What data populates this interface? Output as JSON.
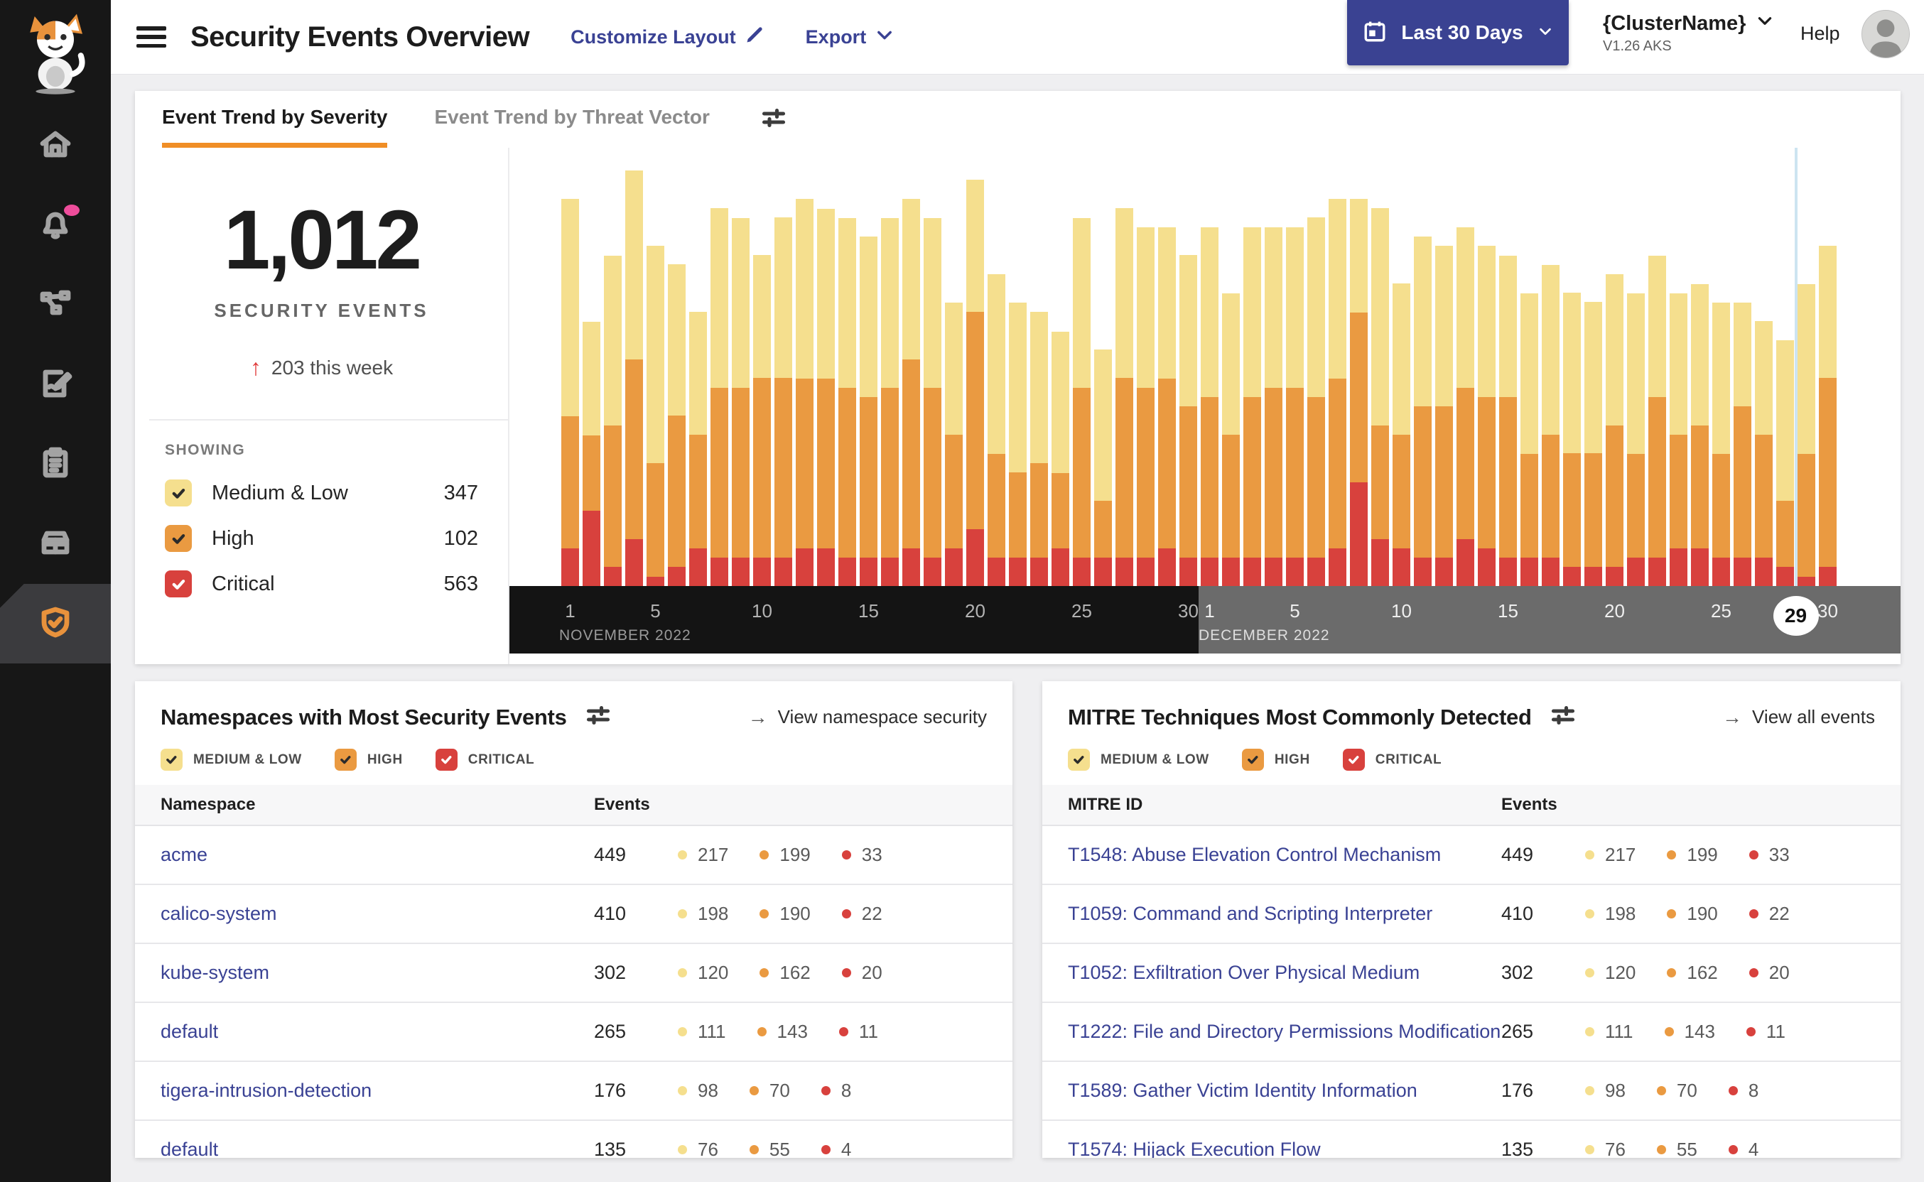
{
  "header": {
    "title": "Security Events Overview",
    "customize_layout": "Customize Layout",
    "export": "Export",
    "date_range": "Last 30 Days",
    "cluster_name": "{ClusterName}",
    "cluster_version": "V1.26 AKS",
    "help": "Help"
  },
  "sidebar": {
    "items": [
      {
        "icon": "home-icon"
      },
      {
        "icon": "bell-icon",
        "badge": true
      },
      {
        "icon": "service-graph-icon"
      },
      {
        "icon": "policy-edit-icon"
      },
      {
        "icon": "compliance-clipboard-icon"
      },
      {
        "icon": "workload-box-icon"
      },
      {
        "icon": "security-shield-icon",
        "active": true
      }
    ]
  },
  "tabs": {
    "items": [
      {
        "label": "Event Trend by Severity",
        "active": true
      },
      {
        "label": "Event Trend by Threat Vector",
        "active": false
      }
    ]
  },
  "summary": {
    "total": "1,012",
    "caption": "SECURITY EVENTS",
    "delta": "203 this week",
    "showing": "SHOWING",
    "legend": [
      {
        "label": "Medium & Low",
        "count": "347",
        "severity": "medium_low"
      },
      {
        "label": "High",
        "count": "102",
        "severity": "high"
      },
      {
        "label": "Critical",
        "count": "563",
        "severity": "critical"
      }
    ]
  },
  "severity_palette": {
    "medium_low": "#F5DF8E",
    "high": "#EA9A41",
    "critical": "#D8413D"
  },
  "chart_data": {
    "type": "bar",
    "stacked": true,
    "series": [
      "Critical",
      "High",
      "Medium & Low"
    ],
    "series_colors": {
      "Critical": "#D8413D",
      "High": "#EA9A41",
      "Medium & Low": "#F5DF8E"
    },
    "y_axis_visible": false,
    "legend_position": "left-panel",
    "highlighted_day": {
      "month": "DECEMBER 2022",
      "day": "29"
    },
    "months": [
      {
        "label": "NOVEMBER 2022",
        "ticks": [
          "1",
          "5",
          "10",
          "15",
          "20",
          "25",
          "30"
        ],
        "values_critical_high_medium": [
          [
            4,
            14,
            23
          ],
          [
            8,
            8,
            12
          ],
          [
            2,
            15,
            18
          ],
          [
            5,
            19,
            20
          ],
          [
            1,
            12,
            23
          ],
          [
            2,
            16,
            16
          ],
          [
            4,
            12,
            13
          ],
          [
            3,
            18,
            19
          ],
          [
            3,
            18,
            18
          ],
          [
            3,
            19,
            13
          ],
          [
            3,
            19,
            17
          ],
          [
            4,
            18,
            19
          ],
          [
            4,
            18,
            18
          ],
          [
            3,
            18,
            18
          ],
          [
            3,
            17,
            17
          ],
          [
            3,
            18,
            18
          ],
          [
            4,
            20,
            17
          ],
          [
            3,
            18,
            18
          ],
          [
            4,
            12,
            14
          ],
          [
            6,
            23,
            14
          ],
          [
            3,
            11,
            19
          ],
          [
            3,
            9,
            18
          ],
          [
            3,
            10,
            16
          ],
          [
            4,
            8,
            15
          ],
          [
            3,
            18,
            18
          ],
          [
            3,
            6,
            16
          ],
          [
            3,
            19,
            18
          ],
          [
            3,
            18,
            17
          ],
          [
            4,
            18,
            16
          ],
          [
            3,
            16,
            16
          ]
        ]
      },
      {
        "label": "DECEMBER 2022",
        "ticks": [
          "1",
          "5",
          "10",
          "15",
          "20",
          "25",
          "30"
        ],
        "values_critical_high_medium": [
          [
            3,
            17,
            18
          ],
          [
            3,
            13,
            15
          ],
          [
            3,
            17,
            18
          ],
          [
            3,
            18,
            17
          ],
          [
            3,
            18,
            17
          ],
          [
            3,
            17,
            19
          ],
          [
            4,
            18,
            19
          ],
          [
            11,
            18,
            12
          ],
          [
            5,
            12,
            23
          ],
          [
            4,
            12,
            16
          ],
          [
            3,
            16,
            18
          ],
          [
            3,
            16,
            17
          ],
          [
            5,
            16,
            17
          ],
          [
            4,
            16,
            16
          ],
          [
            3,
            17,
            15
          ],
          [
            3,
            11,
            17
          ],
          [
            3,
            13,
            18
          ],
          [
            2,
            12,
            17
          ],
          [
            2,
            12,
            16
          ],
          [
            2,
            15,
            16
          ],
          [
            3,
            11,
            17
          ],
          [
            3,
            17,
            15
          ],
          [
            4,
            12,
            15
          ],
          [
            4,
            13,
            15
          ],
          [
            3,
            11,
            16
          ],
          [
            3,
            16,
            11
          ],
          [
            3,
            13,
            12
          ],
          [
            2,
            7,
            17
          ],
          [
            1,
            13,
            18
          ],
          [
            2,
            20,
            14
          ]
        ]
      }
    ]
  },
  "namespaces_card": {
    "title": "Namespaces with Most Security Events",
    "link": "View namespace security",
    "filters": [
      {
        "label": "MEDIUM & LOW",
        "severity": "medium_low"
      },
      {
        "label": "HIGH",
        "severity": "high"
      },
      {
        "label": "CRITICAL",
        "severity": "critical"
      }
    ],
    "columns": [
      "Namespace",
      "Events"
    ],
    "rows": [
      {
        "name": "acme",
        "total": "449",
        "medium_low": "217",
        "high": "199",
        "critical": "33"
      },
      {
        "name": "calico-system",
        "total": "410",
        "medium_low": "198",
        "high": "190",
        "critical": "22"
      },
      {
        "name": "kube-system",
        "total": "302",
        "medium_low": "120",
        "high": "162",
        "critical": "20"
      },
      {
        "name": "default",
        "total": "265",
        "medium_low": "111",
        "high": "143",
        "critical": "11"
      },
      {
        "name": "tigera-intrusion-detection",
        "total": "176",
        "medium_low": "98",
        "high": "70",
        "critical": "8"
      },
      {
        "name": "default",
        "total": "135",
        "medium_low": "76",
        "high": "55",
        "critical": "4"
      }
    ]
  },
  "mitre_card": {
    "title": "MITRE Techniques Most Commonly Detected",
    "link": "View all events",
    "filters": [
      {
        "label": "MEDIUM & LOW",
        "severity": "medium_low"
      },
      {
        "label": "HIGH",
        "severity": "high"
      },
      {
        "label": "CRITICAL",
        "severity": "critical"
      }
    ],
    "columns": [
      "MITRE ID",
      "Events"
    ],
    "rows": [
      {
        "name": "T1548: Abuse Elevation Control Mechanism",
        "total": "449",
        "medium_low": "217",
        "high": "199",
        "critical": "33"
      },
      {
        "name": "T1059: Command and Scripting Interpreter",
        "total": "410",
        "medium_low": "198",
        "high": "190",
        "critical": "22"
      },
      {
        "name": "T1052: Exfiltration Over Physical Medium",
        "total": "302",
        "medium_low": "120",
        "high": "162",
        "critical": "20"
      },
      {
        "name": "T1222: File and Directory Permissions Modification",
        "total": "265",
        "medium_low": "111",
        "high": "143",
        "critical": "11"
      },
      {
        "name": "T1589: Gather Victim Identity Information",
        "total": "176",
        "medium_low": "98",
        "high": "70",
        "critical": "8"
      },
      {
        "name": "T1574: Hijack Execution Flow",
        "total": "135",
        "medium_low": "76",
        "high": "55",
        "critical": "4"
      }
    ]
  }
}
